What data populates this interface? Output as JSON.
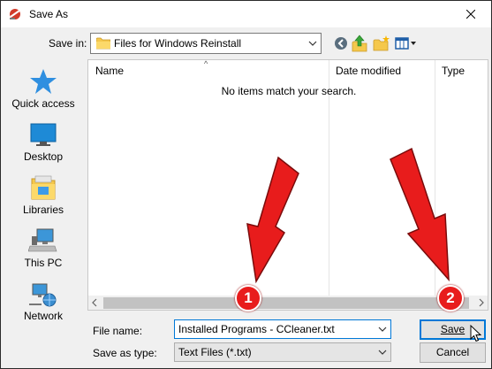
{
  "window": {
    "title": "Save As",
    "close_icon": "close-icon"
  },
  "toolbar": {
    "save_in_label": "Save in:",
    "save_in_value": "Files for Windows Reinstall",
    "icons": [
      "back-icon",
      "up-folder-icon",
      "new-folder-icon",
      "view-menu-icon"
    ]
  },
  "places": [
    {
      "label": "Quick access",
      "icon": "quick-access-star-icon"
    },
    {
      "label": "Desktop",
      "icon": "desktop-icon"
    },
    {
      "label": "Libraries",
      "icon": "libraries-icon"
    },
    {
      "label": "This PC",
      "icon": "this-pc-icon"
    },
    {
      "label": "Network",
      "icon": "network-icon"
    }
  ],
  "file_list": {
    "columns": [
      "Name",
      "Date modified",
      "Type"
    ],
    "empty_message": "No items match your search."
  },
  "form": {
    "file_name_label": "File name:",
    "file_name_value": "Installed Programs - CCleaner.txt",
    "save_type_label": "Save as type:",
    "save_type_value": "Text Files (*.txt)"
  },
  "buttons": {
    "save": "Save",
    "cancel": "Cancel"
  },
  "annotations": {
    "badge_1": "1",
    "badge_2": "2",
    "arrow_color": "#e81c1c"
  }
}
